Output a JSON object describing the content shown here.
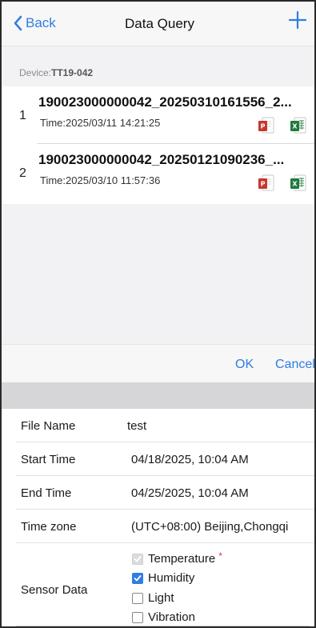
{
  "navbar": {
    "back_label": "Back",
    "title": "Data Query",
    "accent_color": "#2f7de1"
  },
  "device": {
    "label": "Device:",
    "id": "TT19-042"
  },
  "files": [
    {
      "index": "1",
      "name": "190023000000042_20250310161556_2...",
      "time": "Time:2025/03/11 14:21:25",
      "icons": [
        "pdf-icon",
        "excel-icon"
      ]
    },
    {
      "index": "2",
      "name": "190023000000042_20250121090236_...",
      "time": "Time:2025/03/10 11:57:36",
      "icons": [
        "pdf-icon",
        "excel-icon"
      ]
    }
  ],
  "actions": {
    "ok_label": "OK",
    "cancel_label": "Cancel"
  },
  "form": {
    "file_name": {
      "label": "File Name",
      "value": "test"
    },
    "start_time": {
      "label": "Start Time",
      "value": "04/18/2025, 10:04 AM"
    },
    "end_time": {
      "label": "End Time",
      "value": "04/25/2025, 10:04 AM"
    },
    "time_zone": {
      "label": "Time zone",
      "value": "(UTC+08:00) Beijing,Chongqi"
    },
    "sensor_data": {
      "label": "Sensor Data",
      "options": [
        {
          "label": "Temperature",
          "checked": true,
          "disabled": true,
          "required_mark": "*"
        },
        {
          "label": "Humidity",
          "checked": true,
          "disabled": false
        },
        {
          "label": "Light",
          "checked": false,
          "disabled": false
        },
        {
          "label": "Vibration",
          "checked": false,
          "disabled": false
        }
      ]
    }
  }
}
